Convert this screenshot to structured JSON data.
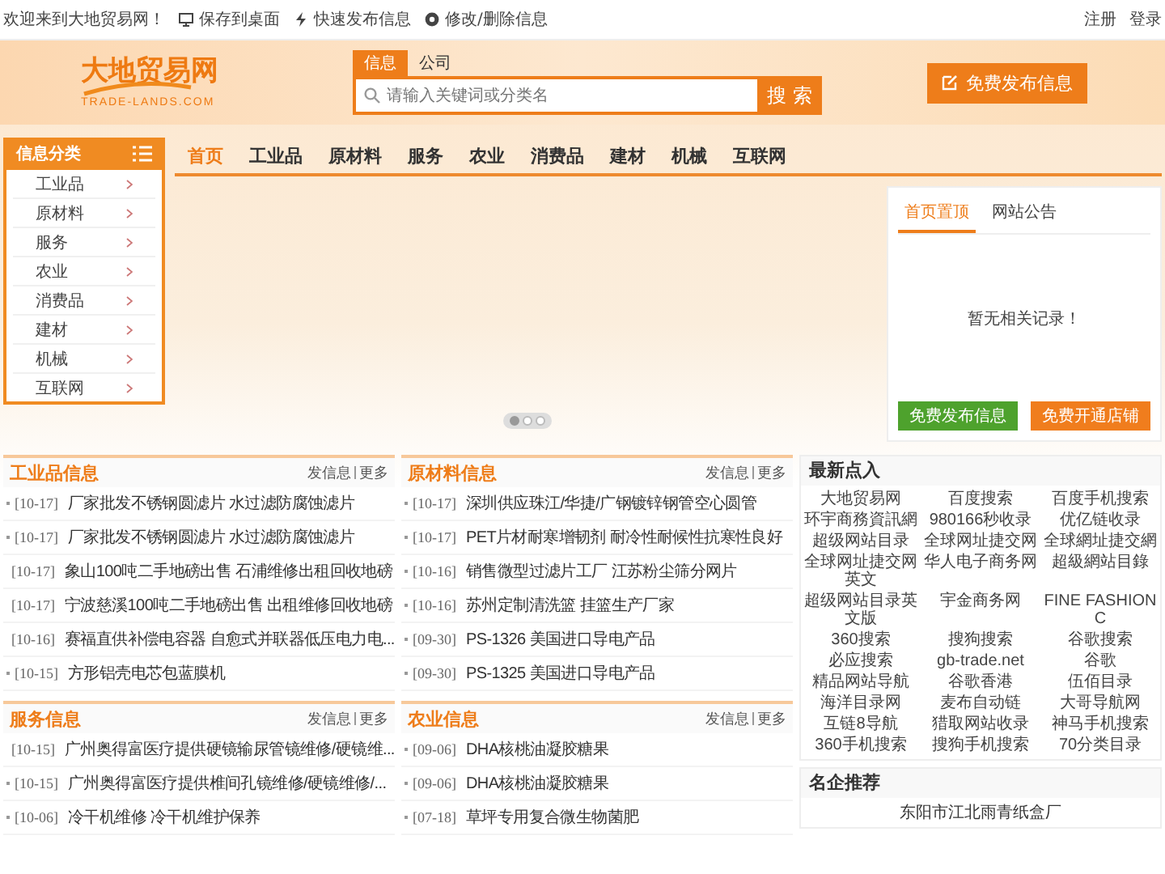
{
  "top_bar": {
    "welcome": "欢迎来到大地贸易网！",
    "links": [
      {
        "kind": "desktop",
        "label": "保存到桌面"
      },
      {
        "kind": "bolt",
        "label": "快速发布信息"
      },
      {
        "kind": "gear",
        "label": "修改/删除信息"
      }
    ],
    "account_links": [
      "注册",
      "登录"
    ]
  },
  "header": {
    "logo": {
      "name": "大地贸易网",
      "domain": "TRADE-LANDS.COM"
    },
    "search": {
      "tabs": [
        {
          "label": "信息",
          "selected": true
        },
        {
          "label": "公司",
          "selected": false
        }
      ],
      "placeholder": "请输入关键词或分类名",
      "button": "搜 索"
    },
    "publish_button": "免费发布信息"
  },
  "nav": [
    {
      "label": "首页",
      "selected": true
    },
    {
      "label": "工业品",
      "selected": false
    },
    {
      "label": "原材料",
      "selected": false
    },
    {
      "label": "服务",
      "selected": false
    },
    {
      "label": "农业",
      "selected": false
    },
    {
      "label": "消费品",
      "selected": false
    },
    {
      "label": "建材",
      "selected": false
    },
    {
      "label": "机械",
      "selected": false
    },
    {
      "label": "互联网",
      "selected": false
    }
  ],
  "sidebar": {
    "title": "信息分类",
    "items": [
      "工业品",
      "原材料",
      "服务",
      "农业",
      "消费品",
      "建材",
      "机械",
      "互联网"
    ]
  },
  "slider": {
    "dots": [
      {
        "selected": true
      },
      {
        "selected": false
      },
      {
        "selected": false
      }
    ]
  },
  "notice_panel": {
    "tabs": [
      {
        "label": "首页置顶",
        "selected": true
      },
      {
        "label": "网站公告",
        "selected": false
      }
    ],
    "empty_text": "暂无相关记录！",
    "buttons": [
      {
        "kind": "green",
        "label": "免费发布信息"
      },
      {
        "kind": "orange",
        "label": "免费开通店铺"
      }
    ]
  },
  "info_sections": [
    {
      "title": "工业品信息",
      "post_link": "发信息",
      "more_link": "更多",
      "rows": [
        {
          "date": "[10-17]",
          "text": "厂家批发不锈钢圆滤片 水过滤防腐蚀滤片"
        },
        {
          "date": "[10-17]",
          "text": "厂家批发不锈钢圆滤片 水过滤防腐蚀滤片"
        },
        {
          "date": "[10-17]",
          "text": "象山100吨二手地磅出售 石浦维修出租回收地磅"
        },
        {
          "date": "[10-17]",
          "text": "宁波慈溪100吨二手地磅出售 出租维修回收地磅"
        },
        {
          "date": "[10-16]",
          "text": "赛福直供补偿电容器 自愈式并联器低压电力电..."
        },
        {
          "date": "[10-15]",
          "text": "方形铝壳电芯包蓝膜机"
        }
      ]
    },
    {
      "title": "原材料信息",
      "post_link": "发信息",
      "more_link": "更多",
      "rows": [
        {
          "date": "[10-17]",
          "text": "深圳供应珠江/华捷/广钢镀锌钢管空心圆管"
        },
        {
          "date": "[10-17]",
          "text": "PET片材耐寒增韧剂 耐冷性耐候性抗寒性良好"
        },
        {
          "date": "[10-16]",
          "text": "销售微型过滤片工厂 江苏粉尘筛分网片"
        },
        {
          "date": "[10-16]",
          "text": "苏州定制清洗篮 挂篮生产厂家"
        },
        {
          "date": "[09-30]",
          "text": "PS-1326 美国进口导电产品"
        },
        {
          "date": "[09-30]",
          "text": "PS-1325 美国进口导电产品"
        }
      ]
    },
    {
      "title": "服务信息",
      "post_link": "发信息",
      "more_link": "更多",
      "rows": [
        {
          "date": "[10-15]",
          "text": "广州奥得富医疗提供硬镜输尿管镜维修/硬镜维..."
        },
        {
          "date": "[10-15]",
          "text": "广州奥得富医疗提供椎间孔镜维修/硬镜维修/..."
        },
        {
          "date": "[10-06]",
          "text": "冷干机维修 冷干机维护保养"
        }
      ]
    },
    {
      "title": "农业信息",
      "post_link": "发信息",
      "more_link": "更多",
      "rows": [
        {
          "date": "[09-06]",
          "text": "DHA核桃油凝胶糖果"
        },
        {
          "date": "[09-06]",
          "text": "DHA核桃油凝胶糖果"
        },
        {
          "date": "[07-18]",
          "text": "草坪专用复合微生物菌肥"
        }
      ]
    }
  ],
  "latest_links": {
    "title": "最新点入",
    "links": [
      "大地贸易网",
      "百度搜索",
      "百度手机搜索",
      "环宇商務資訊網",
      "980166秒收录",
      "优亿链收录",
      "超级网站目录",
      "全球网址捷交网",
      "全球網址捷交網",
      "全球网址捷交网英文",
      "华人电子商务网",
      "超級網站目錄",
      "超级网站目录英文版",
      "宇金商务网",
      "FINE FASHION C",
      "360搜索",
      "搜狗搜索",
      "谷歌搜索",
      "必应搜索",
      "gb-trade.net",
      "谷歌",
      "精品网站导航",
      "谷歌香港",
      "伍佰目录",
      "海洋目录网",
      "麦布自动链",
      "大哥导航网",
      "互链8导航",
      "猎取网站收录",
      "神马手机搜索",
      "360手机搜索",
      "搜狗手机搜索",
      "70分类目录"
    ]
  },
  "featured_companies": {
    "title": "名企推荐",
    "items": [
      "东阳市江北雨青纸盒厂"
    ]
  }
}
